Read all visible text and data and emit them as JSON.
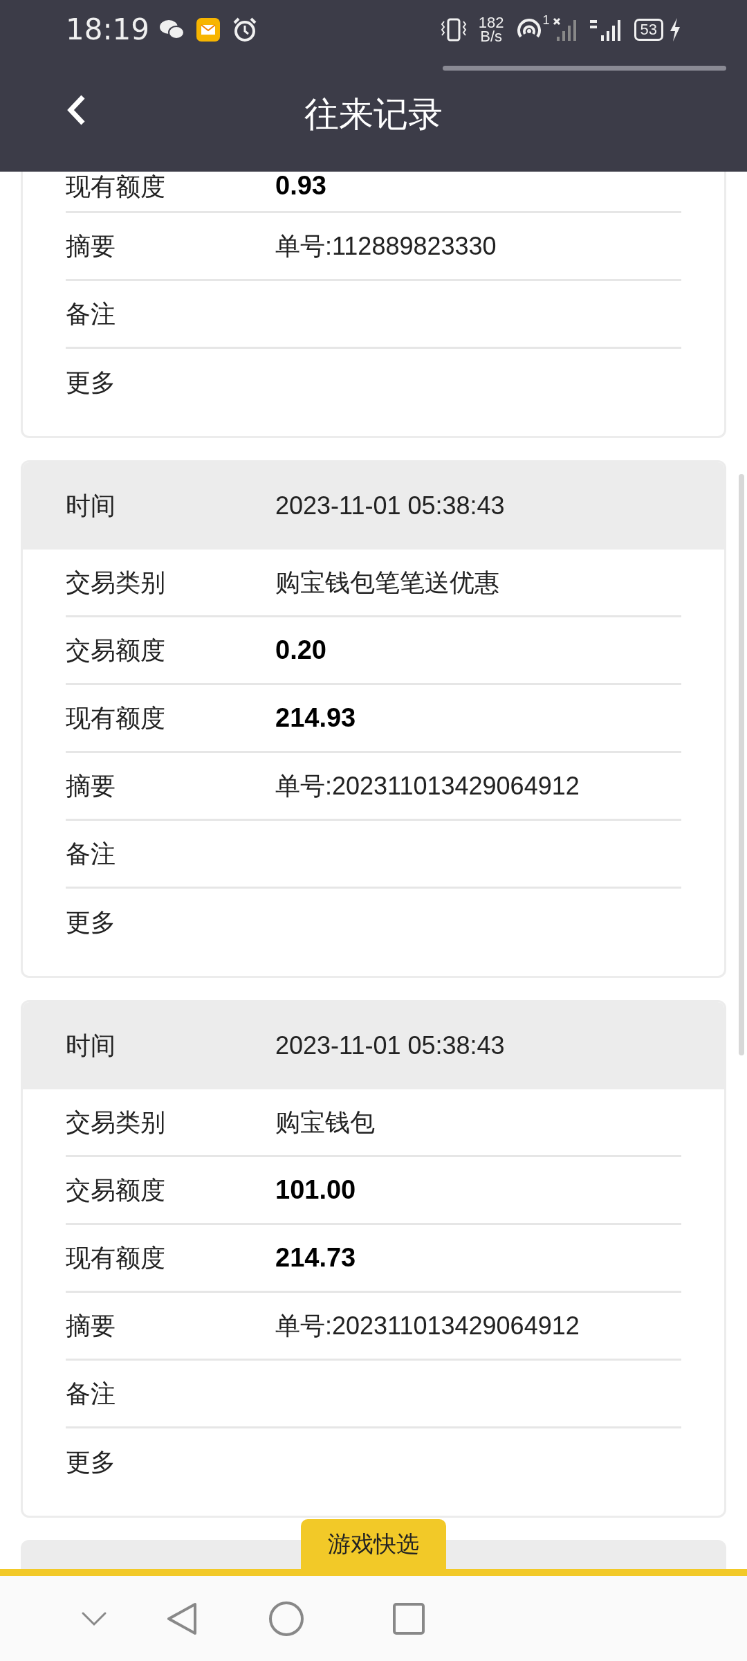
{
  "status_bar": {
    "time": "18:19",
    "net_speed_value": "182",
    "net_speed_unit": "B/s",
    "hotspot_count": "1",
    "battery": "53"
  },
  "header": {
    "title": "往来记录"
  },
  "records": [
    {
      "rows": [
        {
          "label": "现有额度",
          "value": "0.93",
          "kind": "amount"
        },
        {
          "label": "摘要",
          "value": "单号:112889823330",
          "kind": "text"
        },
        {
          "label": "备注"
        },
        {
          "label": "更多"
        }
      ]
    },
    {
      "time_label": "时间",
      "time": "2023-11-01 05:38:43",
      "rows": [
        {
          "label": "交易类别",
          "value": "购宝钱包笔笔送优惠",
          "kind": "text"
        },
        {
          "label": "交易额度",
          "value": "0.20",
          "kind": "amount"
        },
        {
          "label": "现有额度",
          "value": "214.93",
          "kind": "amount"
        },
        {
          "label": "摘要",
          "value": "单号:202311013429064912",
          "kind": "text"
        },
        {
          "label": "备注"
        },
        {
          "label": "更多"
        }
      ]
    },
    {
      "time_label": "时间",
      "time": "2023-11-01 05:38:43",
      "rows": [
        {
          "label": "交易类别",
          "value": "购宝钱包",
          "kind": "text"
        },
        {
          "label": "交易额度",
          "value": "101.00",
          "kind": "amount"
        },
        {
          "label": "现有额度",
          "value": "214.73",
          "kind": "amount"
        },
        {
          "label": "摘要",
          "value": "单号:202311013429064912",
          "kind": "text"
        },
        {
          "label": "备注"
        },
        {
          "label": "更多"
        }
      ]
    }
  ],
  "floating_tab": {
    "label": "游戏快选"
  }
}
